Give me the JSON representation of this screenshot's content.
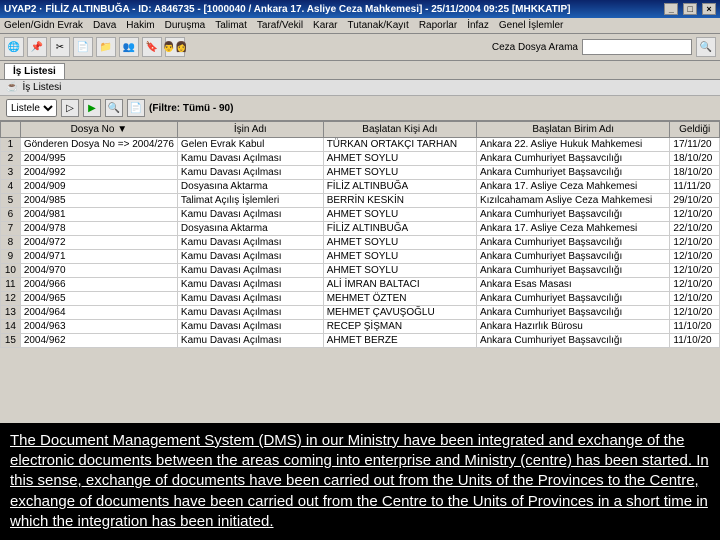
{
  "title": "UYAP2 · FİLİZ ALTINBUĞA - ID: A846735 - [1000040 / Ankara 17. Asliye Ceza Mahkemesi] - 25/11/2004 09:25 [MHKKATIP]",
  "menu": [
    "Gelen/Gidn Evrak",
    "Dava",
    "Hakim",
    "Duruşma",
    "Talimat",
    "Taraf/Vekil",
    "Karar",
    "Tutanak/Kayıt",
    "Raporlar",
    "İnfaz",
    "Genel İşlemler"
  ],
  "search_label": "Ceza Dosya Arama",
  "tab": "İş Listesi",
  "subtitle": "İş Listesi",
  "filter_type": "Listele",
  "filter_text": "(Filtre: Tümü - 90)",
  "columns": [
    "Dosya No ▼",
    "İşin Adı",
    "Başlatan Kişi Adı",
    "Başlatan Birim Adı",
    "Geldiği"
  ],
  "rows": [
    {
      "n": "1",
      "dosya": "Gönderen Dosya No => 2004/276",
      "isin": "Gelen Evrak Kabul",
      "kisi": "TÜRKAN ORTAKÇI TARHAN",
      "birim": "Ankara 22. Asliye Hukuk Mahkemesi",
      "gel": "17/11/20"
    },
    {
      "n": "2",
      "dosya": "2004/995",
      "isin": "Kamu Davası Açılması",
      "kisi": "AHMET SOYLU",
      "birim": "Ankara Cumhuriyet Başsavcılığı",
      "gel": "18/10/20"
    },
    {
      "n": "3",
      "dosya": "2004/992",
      "isin": "Kamu Davası Açılması",
      "kisi": "AHMET SOYLU",
      "birim": "Ankara Cumhuriyet Başsavcılığı",
      "gel": "18/10/20"
    },
    {
      "n": "4",
      "dosya": "2004/909",
      "isin": "Dosyasına Aktarma",
      "kisi": "FİLİZ ALTINBUĞA",
      "birim": "Ankara 17. Asliye Ceza Mahkemesi",
      "gel": "11/11/20"
    },
    {
      "n": "5",
      "dosya": "2004/985",
      "isin": "Talimat Açılış İşlemleri",
      "kisi": "BERRİN KESKİN",
      "birim": "Kızılcahamam Asliye Ceza Mahkemesi",
      "gel": "29/10/20"
    },
    {
      "n": "6",
      "dosya": "2004/981",
      "isin": "Kamu Davası Açılması",
      "kisi": "AHMET SOYLU",
      "birim": "Ankara Cumhuriyet Başsavcılığı",
      "gel": "12/10/20"
    },
    {
      "n": "7",
      "dosya": "2004/978",
      "isin": "Dosyasına Aktarma",
      "kisi": "FİLİZ ALTINBUĞA",
      "birim": "Ankara 17. Asliye Ceza Mahkemesi",
      "gel": "22/10/20"
    },
    {
      "n": "8",
      "dosya": "2004/972",
      "isin": "Kamu Davası Açılması",
      "kisi": "AHMET SOYLU",
      "birim": "Ankara Cumhuriyet Başsavcılığı",
      "gel": "12/10/20"
    },
    {
      "n": "9",
      "dosya": "2004/971",
      "isin": "Kamu Davası Açılması",
      "kisi": "AHMET SOYLU",
      "birim": "Ankara Cumhuriyet Başsavcılığı",
      "gel": "12/10/20"
    },
    {
      "n": "10",
      "dosya": "2004/970",
      "isin": "Kamu Davası Açılması",
      "kisi": "AHMET SOYLU",
      "birim": "Ankara Cumhuriyet Başsavcılığı",
      "gel": "12/10/20"
    },
    {
      "n": "11",
      "dosya": "2004/966",
      "isin": "Kamu Davası Açılması",
      "kisi": "ALİ İMRAN BALTACI",
      "birim": "Ankara Esas Masası",
      "gel": "12/10/20"
    },
    {
      "n": "12",
      "dosya": "2004/965",
      "isin": "Kamu Davası Açılması",
      "kisi": "MEHMET ÖZTEN",
      "birim": "Ankara Cumhuriyet Başsavcılığı",
      "gel": "12/10/20"
    },
    {
      "n": "13",
      "dosya": "2004/964",
      "isin": "Kamu Davası Açılması",
      "kisi": "MEHMET ÇAVUŞOĞLU",
      "birim": "Ankara Cumhuriyet Başsavcılığı",
      "gel": "12/10/20"
    },
    {
      "n": "14",
      "dosya": "2004/963",
      "isin": "Kamu Davası Açılması",
      "kisi": "RECEP ŞİŞMAN",
      "birim": "Ankara Hazırlık Bürosu",
      "gel": "11/10/20"
    },
    {
      "n": "15",
      "dosya": "2004/962",
      "isin": "Kamu Davası Açılması",
      "kisi": "AHMET BERZE",
      "birim": "Ankara Cumhuriyet Başsavcılığı",
      "gel": "11/10/20"
    }
  ],
  "overlay": "The Document Management System (DMS) in our Ministry have been integrated and exchange of the electronic documents between the areas coming into enterprise and Ministry (centre) has been started. In this sense, exchange of documents have been carried out from the Units of the Provinces to the Centre,  exchange of documents have been carried out from the Centre to the Units of Provinces in a short time in which the integration has been initiated."
}
